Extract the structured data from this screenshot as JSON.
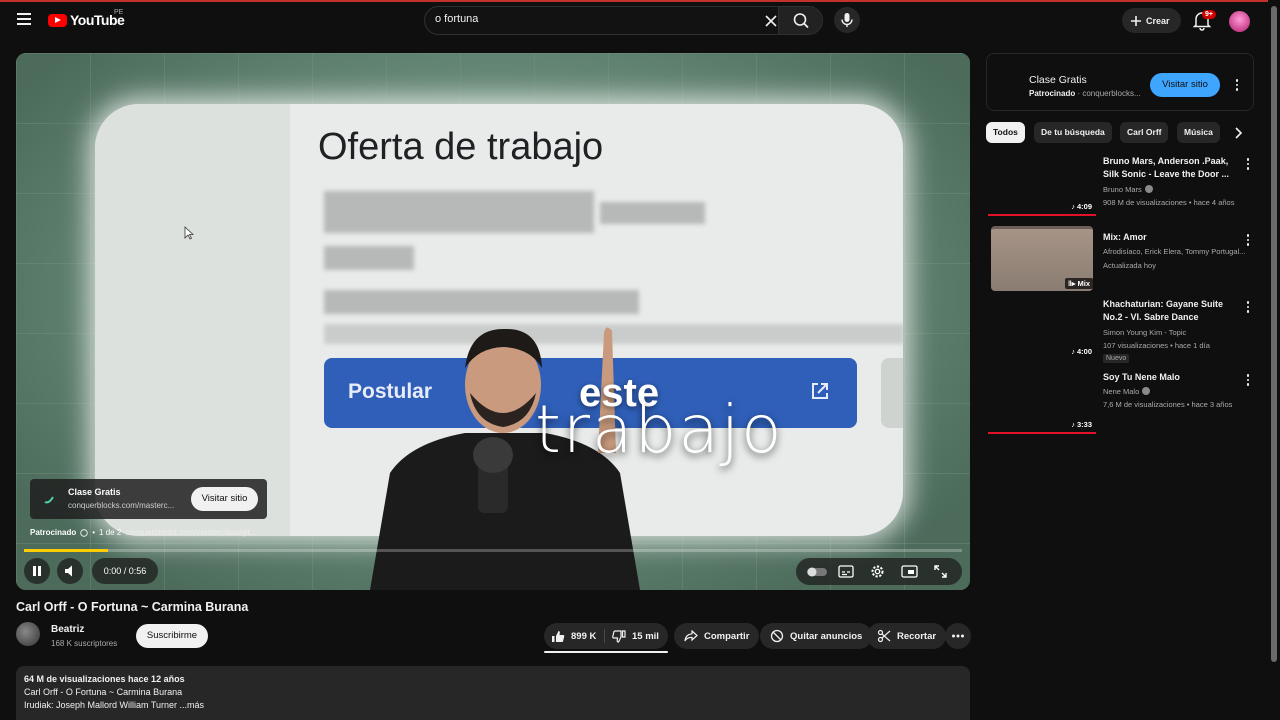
{
  "header": {
    "logo_text": "YouTube",
    "country_code": "PE",
    "search_value": "o fortuna",
    "create_label": "Crear",
    "notif_badge": "9+"
  },
  "player": {
    "job_title": "Oferta de trabajo",
    "apply_text": "Postular",
    "overlay_word_1": "este",
    "overlay_word_2": "trabajo",
    "ad_title": "Clase Gratis",
    "ad_url": "conquerblocks.com/masterc...",
    "ad_visit": "Visitar sitio",
    "sponsored": "Patrocinado",
    "ad_count": "1 de 2",
    "ad_url_faint": "conquerblocks.com/masterclass/git...",
    "progress": 0.09,
    "time": "0:00 / 0:56"
  },
  "video": {
    "title": "Carl Orff - O Fortuna ~ Carmina Burana",
    "channel": "Beatriz",
    "subscribers": "168 K suscriptores",
    "subscribe": "Suscribirme",
    "likes": "899 K",
    "dislikes": "15 mil",
    "share": "Compartir",
    "remove_ads": "Quitar anuncios",
    "clip": "Recortar"
  },
  "description": {
    "stats": "64 M de visualizaciones  hace 12 años",
    "line2": "Carl Orff - O Fortuna ~ Carmina Burana",
    "line3": "Irudiak: Joseph Mallord William Turner ...más"
  },
  "sidebar": {
    "ad": {
      "title": "Clase Gratis",
      "sponsored": "Patrocinado",
      "domain": "conquerblocks...",
      "visit": "Visitar sitio"
    },
    "chips": [
      "Todos",
      "De tu búsqueda",
      "Carl Orff",
      "Música"
    ],
    "recs": [
      {
        "title": "Bruno Mars, Anderson .Paak, Silk Sonic - Leave the Door ...",
        "channel": "Bruno Mars",
        "meta": "908 M de visualizaciones • hace 4 años",
        "duration": "4:09"
      },
      {
        "title": "Mix: Amor",
        "channel": "Afrodisíaco, Erick Elera, Tommy Portugal...",
        "meta": "Actualizada hoy",
        "duration": "Mix"
      },
      {
        "title": "Khachaturian: Gayane Suite No.2 - VI. Sabre Dance",
        "channel": "Simon Young Kim - Topic",
        "meta": "107 visualizaciones • hace 1 día",
        "duration": "4:00",
        "badge": "Nuevo"
      },
      {
        "title": "Soy Tu Nene Malo",
        "channel": "Nene Malo",
        "meta": "7,6 M de visualizaciones • hace 3 años",
        "duration": "3:33"
      }
    ]
  },
  "colors": {
    "accent_red": "#ff0000",
    "progress": "#ffcc00",
    "visit_blue": "#3ea6ff",
    "rec_bar": "#e3102a"
  }
}
